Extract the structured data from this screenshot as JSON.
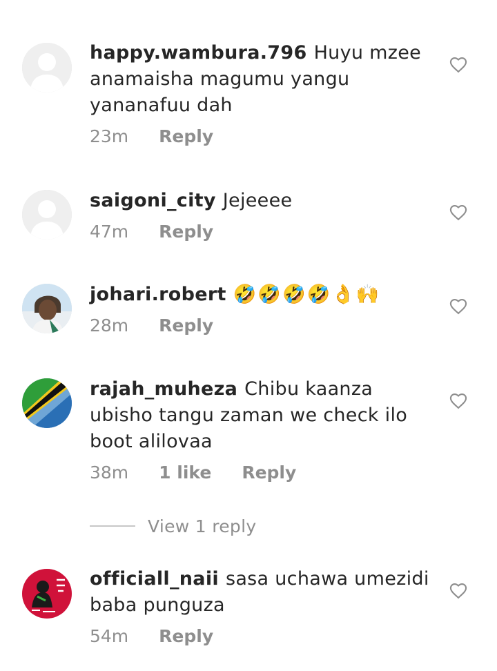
{
  "comments": [
    {
      "username": "happy.wambura.796",
      "text": "Huyu mzee anamaisha magumu yangu yananafuu dah",
      "time": "23m",
      "likes": "",
      "reply_label": "Reply",
      "avatar": "default-avatar"
    },
    {
      "username": "saigoni_city",
      "text": "Jejeeee",
      "time": "47m",
      "likes": "",
      "reply_label": "Reply",
      "avatar": "default-avatar"
    },
    {
      "username": "johari.robert",
      "text": "🤣🤣🤣🤣👌🙌",
      "time": "28m",
      "likes": "",
      "reply_label": "Reply",
      "avatar": "profile-photo"
    },
    {
      "username": "rajah_muheza",
      "text": "Chibu kaanza ubisho tangu zaman we check ilo boot alilovaa",
      "time": "38m",
      "likes": "1 like",
      "reply_label": "Reply",
      "avatar": "tanzania-flag"
    },
    {
      "username": "officiall_naii",
      "text": "sasa uchawa umezidi baba punguza",
      "time": "54m",
      "likes": "",
      "reply_label": "Reply",
      "avatar": "logo-avatar"
    }
  ],
  "view_replies_label": "View 1 reply",
  "icons": {
    "like": "heart-outline-icon"
  },
  "colors": {
    "text": "#262626",
    "meta": "#8e8e8e",
    "avatar_placeholder": "#dbdbdb"
  }
}
